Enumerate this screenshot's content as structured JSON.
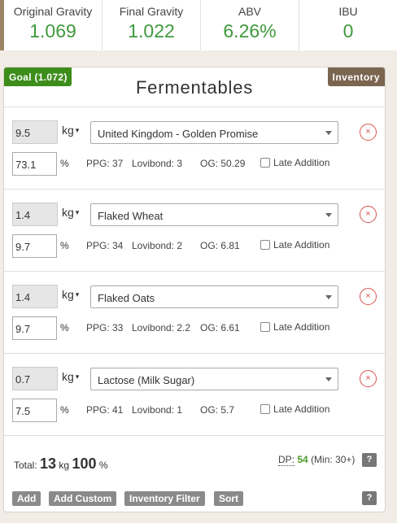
{
  "stats": [
    {
      "label": "Original Gravity",
      "value": "1.069"
    },
    {
      "label": "Final Gravity",
      "value": "1.022"
    },
    {
      "label": "ABV",
      "value": "6.26%"
    },
    {
      "label": "IBU",
      "value": "0"
    }
  ],
  "colors": {
    "accent_green": "#3f9a3c",
    "goal_badge": "#3d8d1b",
    "inventory_badge": "#7a6550",
    "remove_red": "#d9534f"
  },
  "panel": {
    "goal_label": "Goal (1.072)",
    "inventory_label": "Inventory",
    "title": "Fermentables"
  },
  "fermentables": [
    {
      "amount": "9.5",
      "unit": "kg",
      "name": "United Kingdom - Golden Promise",
      "percent": "73.1",
      "ppg": "PPG: 37",
      "lovibond": "Lovibond: 3",
      "og": "OG: 50.29",
      "late_label": "Late Addition",
      "late_checked": false,
      "remove_icon": "×"
    },
    {
      "amount": "1.4",
      "unit": "kg",
      "name": "Flaked Wheat",
      "percent": "9.7",
      "ppg": "PPG: 34",
      "lovibond": "Lovibond: 2",
      "og": "OG: 6.81",
      "late_label": "Late Addition",
      "late_checked": false,
      "remove_icon": "×"
    },
    {
      "amount": "1.4",
      "unit": "kg",
      "name": "Flaked Oats",
      "percent": "9.7",
      "ppg": "PPG: 33",
      "lovibond": "Lovibond: 2.2",
      "og": "OG: 6.61",
      "late_label": "Late Addition",
      "late_checked": false,
      "remove_icon": "×"
    },
    {
      "amount": "0.7",
      "unit": "kg",
      "name": "Lactose (Milk Sugar)",
      "percent": "7.5",
      "ppg": "PPG: 41",
      "lovibond": "Lovibond: 1",
      "og": "OG: 5.7",
      "late_label": "Late Addition",
      "late_checked": false,
      "remove_icon": "×"
    }
  ],
  "percent_sign": "%",
  "unit_caret": "▾",
  "total": {
    "label": "Total:",
    "weight": "13",
    "weight_unit": "kg",
    "percent": "100",
    "percent_unit": "%"
  },
  "dp": {
    "label": "DP:",
    "value": "54",
    "min": "(Min: 30+)"
  },
  "help_label": "?",
  "buttons": {
    "add": "Add",
    "add_custom": "Add Custom",
    "inventory_filter": "Inventory Filter",
    "sort": "Sort"
  }
}
